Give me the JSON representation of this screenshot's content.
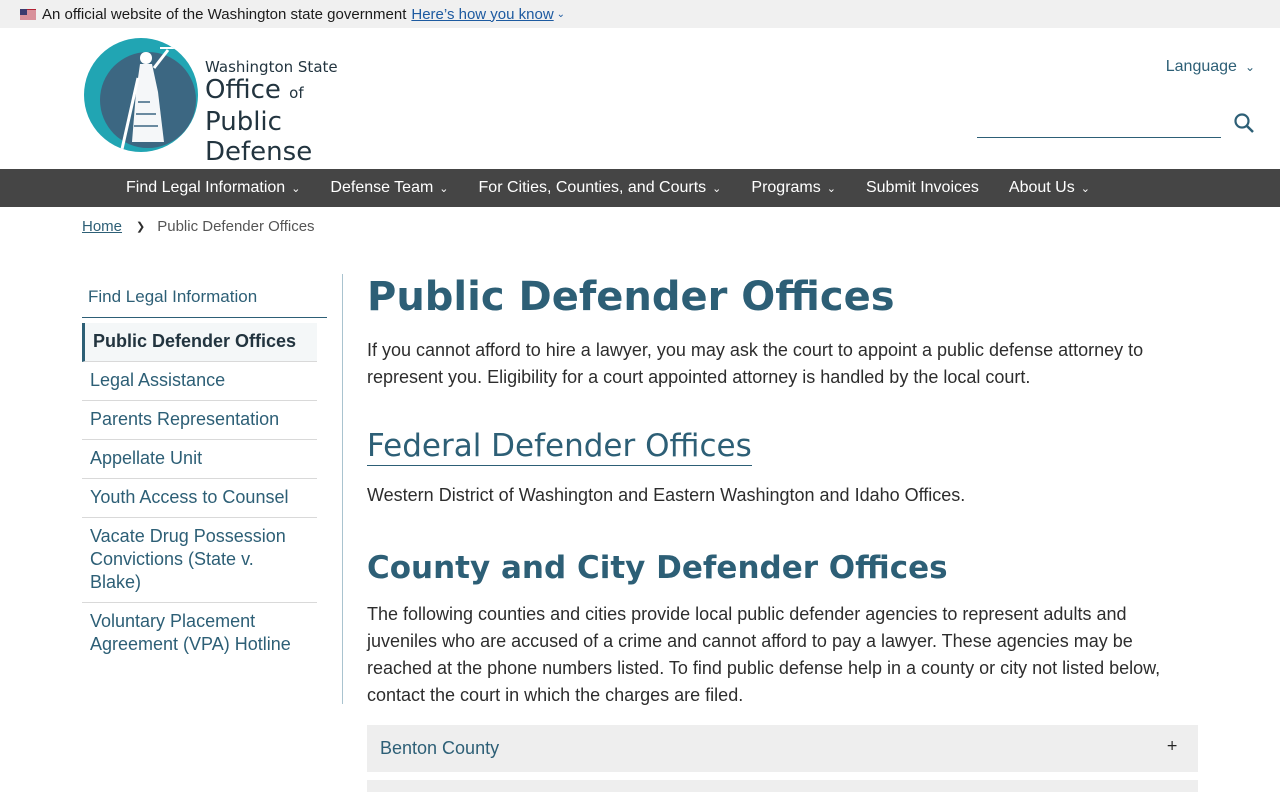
{
  "gov_banner": {
    "text": "An official website of the Washington state government",
    "link": "Here’s how you know",
    "flag_icon": "us-flag-icon"
  },
  "logo": {
    "line1": "Washington State",
    "line2": "Office",
    "line2_small": "of",
    "line3": "Public Defense",
    "colors": {
      "outer": "#21a5b3",
      "inner": "#3c6782"
    }
  },
  "header": {
    "language": "Language",
    "search_placeholder": "",
    "search_icon": "search-icon"
  },
  "nav": {
    "items": [
      {
        "label": "Find Legal Information",
        "dropdown": true
      },
      {
        "label": "Defense Team",
        "dropdown": true
      },
      {
        "label": "For Cities, Counties, and Courts",
        "dropdown": true
      },
      {
        "label": "Programs",
        "dropdown": true
      },
      {
        "label": "Submit Invoices",
        "dropdown": false
      },
      {
        "label": "About Us",
        "dropdown": true
      }
    ]
  },
  "breadcrumb": {
    "home": "Home",
    "current": "Public Defender Offices"
  },
  "sidebar": {
    "title": "Find Legal Information",
    "items": [
      {
        "label": "Public Defender Offices",
        "active": true
      },
      {
        "label": "Legal Assistance"
      },
      {
        "label": "Parents Representation"
      },
      {
        "label": "Appellate Unit"
      },
      {
        "label": "Youth Access to Counsel"
      },
      {
        "label": "Vacate Drug Possession Convictions (State v. Blake)"
      },
      {
        "label": "Voluntary Placement Agreement (VPA) Hotline"
      }
    ]
  },
  "main": {
    "title": "Public Defender Offices",
    "intro": "If you cannot afford to hire a lawyer, you may ask the court to appoint a public defense attorney to represent you. Eligibility for a court appointed attorney is handled by the local court.",
    "federal_heading": "Federal Defender Offices",
    "federal_text": "Western District of Washington and Eastern Washington and Idaho Offices.",
    "county_heading": "County and City Defender Offices",
    "county_text": "The following counties and cities provide local public defender agencies to represent adults and juveniles who are accused of a crime and cannot afford to pay a lawyer. These agencies may be reached at the phone numbers listed. To find public defense help in a county or city not listed below, contact the court in which the charges are filed.",
    "accordion": [
      {
        "label": "Benton County",
        "icon": "+"
      }
    ]
  }
}
